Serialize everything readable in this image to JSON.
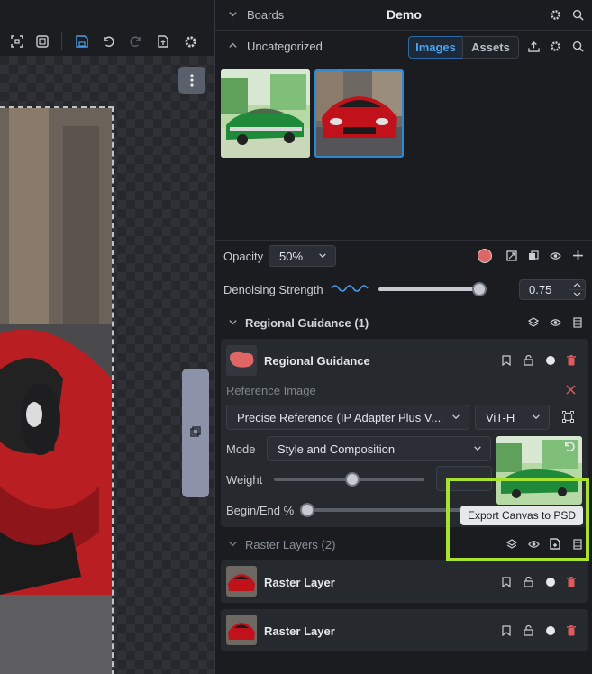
{
  "boards": {
    "label": "Boards",
    "title": "Demo"
  },
  "gallery": {
    "section": "Uncategorized",
    "tabs": [
      {
        "label": "Images",
        "active": true
      },
      {
        "label": "Assets",
        "active": false
      }
    ]
  },
  "opacity": {
    "label": "Opacity",
    "value": "50%",
    "swatch_color": "#e06666"
  },
  "denoise": {
    "label": "Denoising Strength",
    "value": "0.75",
    "level": 0.75
  },
  "regional": {
    "group_label": "Regional Guidance (1)",
    "layer_name": "Regional Guidance",
    "ref_label": "Reference Image",
    "model": "Precise Reference (IP Adapter Plus V...",
    "clip": "ViT-H",
    "mode_label": "Mode",
    "mode_value": "Style and Composition",
    "weight_label": "Weight",
    "begin_end_label": "Begin/End %"
  },
  "tooltip": "Export Canvas to PSD",
  "raster": {
    "group_label": "Raster Layers (2)",
    "layers": [
      {
        "name": "Raster Layer"
      },
      {
        "name": "Raster Layer"
      }
    ]
  },
  "colors": {
    "accent": "#2b8ad8",
    "highlight": "#a6e22e",
    "delete": "#e05c5c"
  }
}
